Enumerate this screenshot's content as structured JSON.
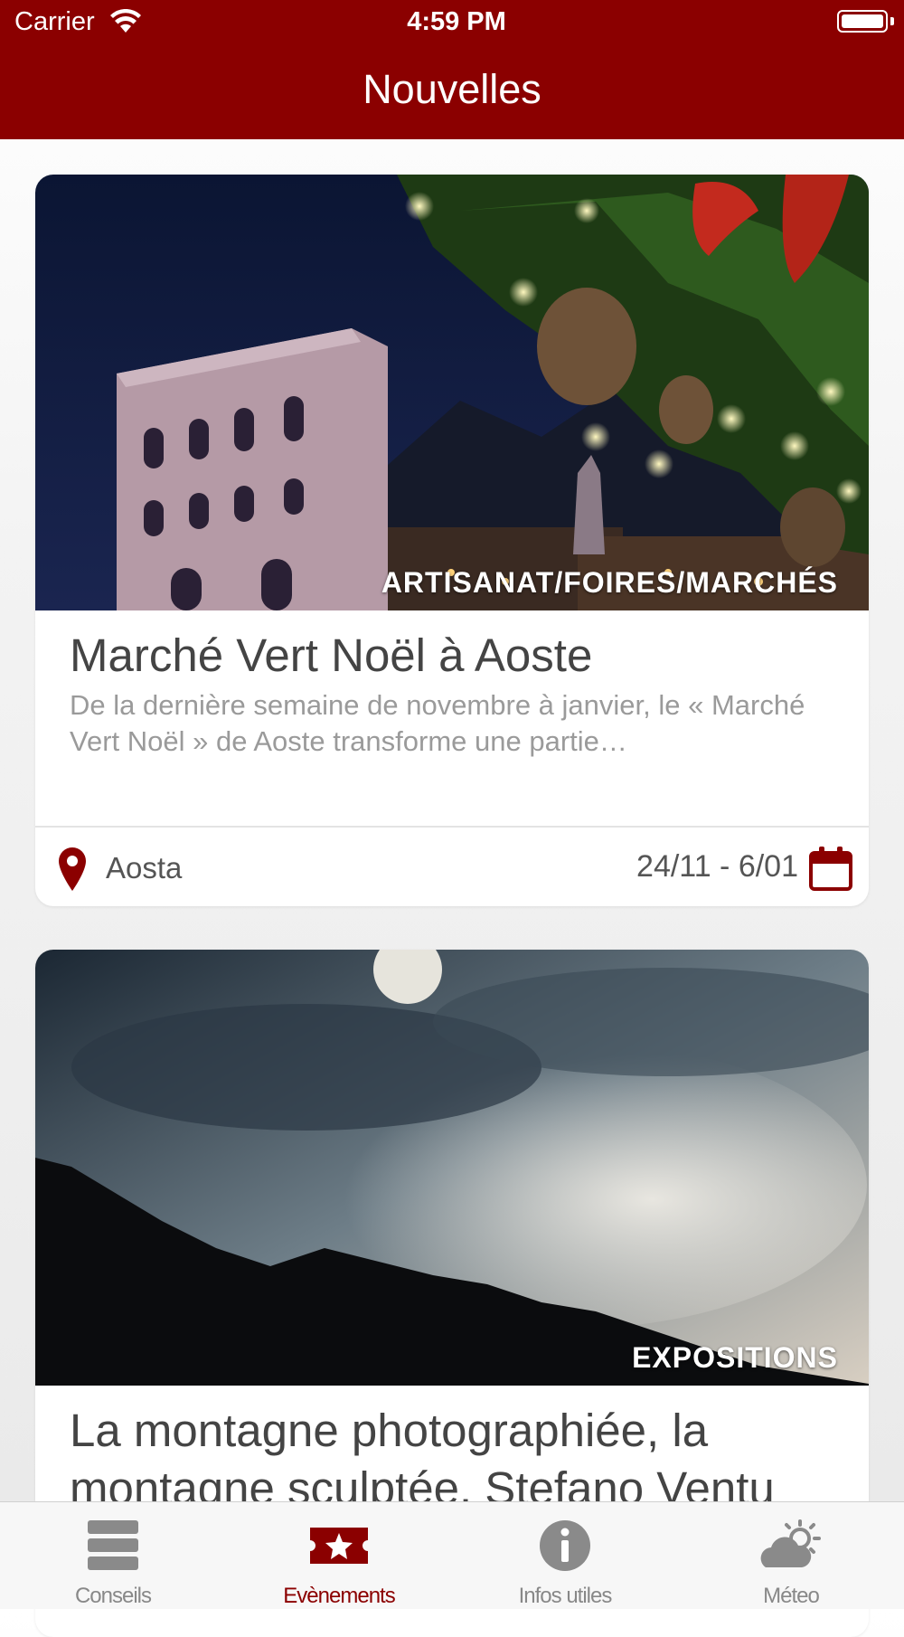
{
  "status_bar": {
    "carrier": "Carrier",
    "time": "4:59 PM"
  },
  "nav": {
    "title": "Nouvelles"
  },
  "events": [
    {
      "category": "ARTISANAT/FOIRES/MARCHÉS",
      "title": "Marché Vert Noël à Aoste",
      "description": "De la dernière semaine de novembre à janvier, le « Marché Vert Noël » de Aoste transforme une partie…",
      "location": "Aosta",
      "dates": "24/11 - 6/01"
    },
    {
      "category": "EXPOSITIONS",
      "title": "La montagne photographiée, la montagne sculptée. Stefano Ventu"
    }
  ],
  "tabs": [
    {
      "label": "Conseils",
      "icon": "list-icon"
    },
    {
      "label": "Evènements",
      "icon": "ticket-star-icon",
      "active": true
    },
    {
      "label": "Infos utiles",
      "icon": "info-icon"
    },
    {
      "label": "Méteo",
      "icon": "weather-icon"
    }
  ],
  "colors": {
    "brand": "#8b0000",
    "tab_inactive": "#888888"
  }
}
